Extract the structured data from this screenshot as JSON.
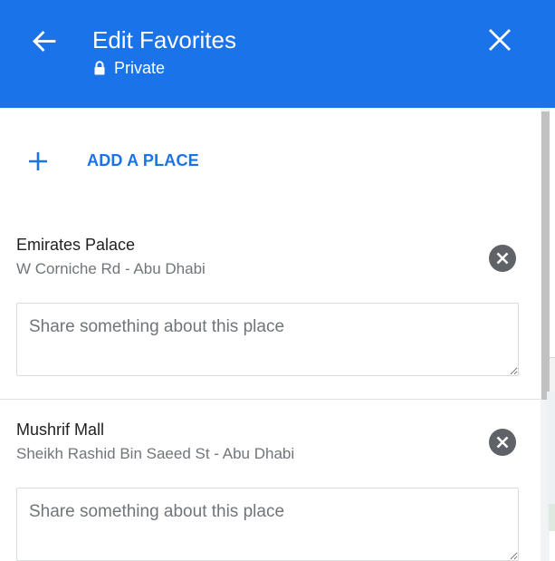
{
  "header": {
    "title": "Edit Favorites",
    "privacy_label": "Private",
    "back_icon": "arrow-back-icon",
    "close_icon": "close-icon",
    "lock_icon": "lock-icon",
    "background_color": "#1a73e8"
  },
  "actions": {
    "add_place_label": "ADD A PLACE",
    "add_icon": "plus-icon",
    "accent_color": "#1a73e8"
  },
  "places": [
    {
      "name": "Emirates Palace",
      "address": "W Corniche Rd - Abu Dhabi",
      "note_placeholder": "Share something about this place",
      "note_value": ""
    },
    {
      "name": "Mushrif Mall",
      "address": "Sheikh Rashid Bin Saeed St - Abu Dhabi",
      "note_placeholder": "Share something about this place",
      "note_value": ""
    }
  ]
}
